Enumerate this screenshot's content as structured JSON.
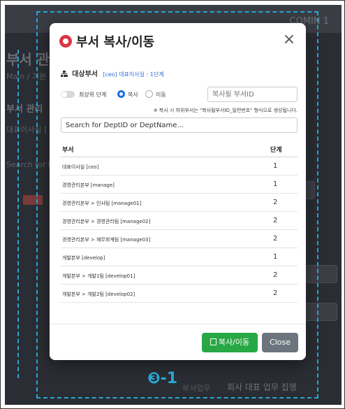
{
  "background": {
    "user_label": "COMIN 1",
    "page_title": "부서 관리",
    "breadcrumb": "Main / 기본 설정",
    "section_label": "부서 관리",
    "side_label": "대표이사실 [",
    "search_label": "Search for D",
    "footer_label": "부서업무",
    "footer_value": "회사 대표 업무 집행"
  },
  "annotation": {
    "badge": "❸-1"
  },
  "modal": {
    "title": "부서 복사/이동",
    "close_symbol": "×",
    "target_label": "대상부서",
    "target_value": "[ceo] 대표이사실 : 1단계",
    "top_level_label": "최상위 단계",
    "copy_label": "복사",
    "move_label": "이동",
    "dest_placeholder": "복사될 부서ID",
    "note": "※ 복사 시 하위부서는 \"복사될부서ID_일련번호\" 형식으로 생성됩니다.",
    "search_placeholder": "Search for DeptID or DeptName...",
    "columns": {
      "dept": "부서",
      "level": "단계"
    },
    "rows": [
      {
        "name": "대표이사실 [ceo]",
        "level": "1"
      },
      {
        "name": "경영관리본부 [manage]",
        "level": "1"
      },
      {
        "name": "경영관리본부 > 인사팀 [manage01]",
        "level": "2"
      },
      {
        "name": "경영관리본부 > 경영관리팀 [manage02]",
        "level": "2"
      },
      {
        "name": "경영관리본부 > 재무회계팀 [manage03]",
        "level": "2"
      },
      {
        "name": "개발본부 [develop]",
        "level": "1"
      },
      {
        "name": "개발본부 > 개발1팀 [develop01]",
        "level": "2"
      },
      {
        "name": "개발본부 > 개발2팀 [develop02]",
        "level": "2"
      }
    ],
    "copy_move_button": "복사/이동",
    "close_button": "Close"
  },
  "colors": {
    "accent_blue": "#27a7d6",
    "copy_button": "#28a745",
    "close_button": "#6c757d",
    "title_icon": "#dc3545"
  }
}
